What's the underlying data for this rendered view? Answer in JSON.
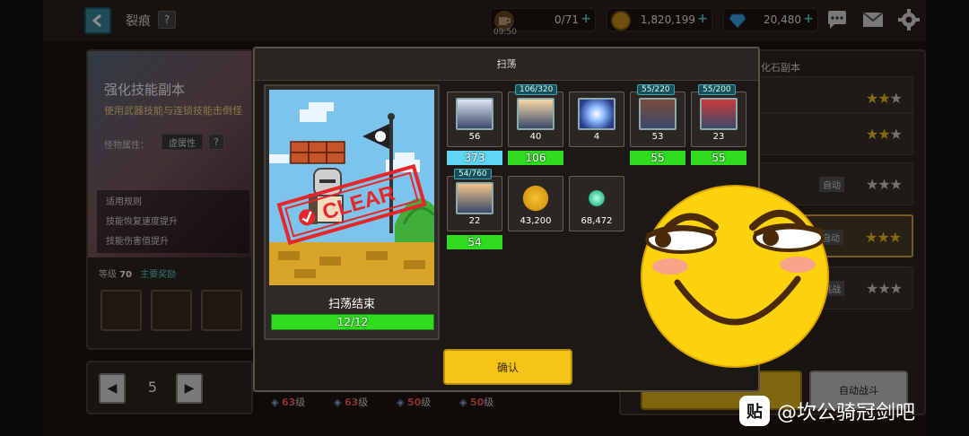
{
  "topbar": {
    "title": "裂痕",
    "help": "?",
    "stamina": {
      "value": "0/71",
      "time": "09:50"
    },
    "gold": {
      "value": "1,820,199"
    },
    "gems": {
      "value": "20,480"
    },
    "plus": "+"
  },
  "left_panel": {
    "title": "强化技能副本",
    "desc": "使用武器技能与连锁技能击倒怪",
    "attr_label": "怪物属性：",
    "attr_value": "虚属性",
    "attr_help": "?",
    "rules_header": "适用规则",
    "rule_1": "技能恢复速度提升",
    "rule_2": "技能伤害值提升",
    "level_label": "等级",
    "level_value": "70",
    "reward_label": "主要奖励"
  },
  "stepper": {
    "value": "5",
    "prev": "◀",
    "next": "▶"
  },
  "right_panel": {
    "title": "化石副本",
    "rows": [
      {
        "tag": "",
        "stars": "★★★",
        "filled": 2
      },
      {
        "tag": "",
        "stars": "★★☆",
        "filled": 2
      },
      {
        "tag": "自动",
        "stars": "★★★",
        "filled": 0
      },
      {
        "tag": "自动",
        "stars": "★★★",
        "filled": 3
      },
      {
        "tag": "挑战",
        "stars": "★★★",
        "filled": 0
      }
    ],
    "auto_battle": "自动战斗"
  },
  "bottom_strip": [
    {
      "num": "63",
      "unit": "级"
    },
    {
      "num": "63",
      "unit": "级"
    },
    {
      "num": "50",
      "unit": "级"
    },
    {
      "num": "50",
      "unit": "级"
    }
  ],
  "modal": {
    "title": "扫荡",
    "stamp_text": "CLEAR",
    "scene_caption": "扫荡结束",
    "progress_text": "12/12",
    "progress_fraction": 1.0,
    "confirm": "确认",
    "rewards": [
      {
        "kind": "hero",
        "count": "56",
        "fragment": "",
        "bar": "373",
        "bar_color": "blue",
        "portrait": "#dfe6f4"
      },
      {
        "kind": "hero",
        "count": "40",
        "fragment": "106/320",
        "bar": "106",
        "bar_color": "green",
        "portrait": "#f6d9a8"
      },
      {
        "kind": "crystal",
        "count": "4",
        "fragment": "",
        "bar": "",
        "bar_color": "",
        "portrait": ""
      },
      {
        "kind": "hero",
        "count": "53",
        "fragment": "55/220",
        "bar": "55",
        "bar_color": "green",
        "portrait": "#7a4a3a"
      },
      {
        "kind": "hero",
        "count": "23",
        "fragment": "55/200",
        "bar": "55",
        "bar_color": "green",
        "portrait": "#cc3a3a"
      },
      {
        "kind": "hero",
        "count": "22",
        "fragment": "54/760",
        "bar": "54",
        "bar_color": "green",
        "portrait": "#f2c48a"
      },
      {
        "kind": "gold",
        "count": "43,200",
        "fragment": "",
        "bar": "",
        "bar_color": "",
        "portrait": ""
      },
      {
        "kind": "gem",
        "count": "68,472",
        "fragment": "",
        "bar": "",
        "bar_color": "",
        "portrait": ""
      }
    ]
  },
  "watermark": {
    "logo": "贴",
    "text": "@坎公骑冠剑吧"
  }
}
